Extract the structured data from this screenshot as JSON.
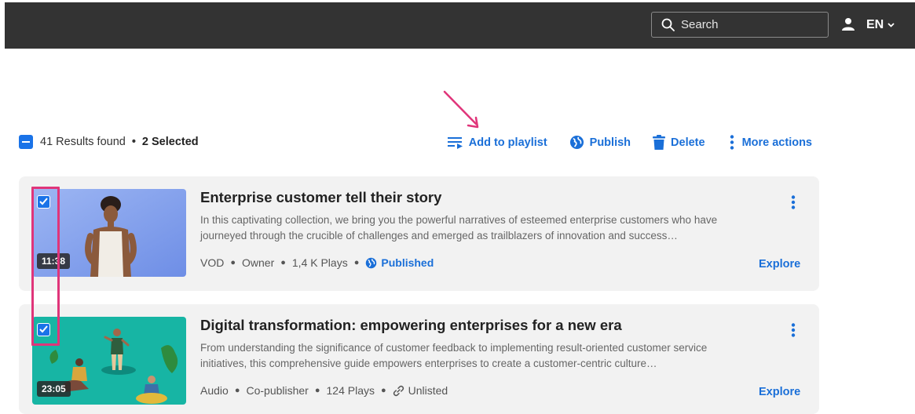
{
  "header": {
    "search_placeholder": "Search",
    "language": "EN"
  },
  "toolbar": {
    "results_text": "41 Results found",
    "selected_text": "2 Selected",
    "actions": [
      {
        "label": "Add to playlist",
        "icon": "add-to-playlist-icon"
      },
      {
        "label": "Publish",
        "icon": "globe-icon"
      },
      {
        "label": "Delete",
        "icon": "trash-icon"
      },
      {
        "label": "More actions",
        "icon": "kebab-icon"
      }
    ]
  },
  "entries": [
    {
      "title": "Enterprise customer tell their story",
      "description": "In this captivating collection, we bring you the powerful narratives of esteemed enterprise customers who have journeyed through the crucible of challenges and emerged as trailblazers of innovation and success…",
      "duration": "11:38",
      "type": "VOD",
      "role": "Owner",
      "plays": "1,4 K Plays",
      "status": "Published",
      "status_icon": "globe-icon",
      "explore": "Explore",
      "selected": true
    },
    {
      "title": "Digital transformation: empowering enterprises for a new era",
      "description": "From understanding the significance of customer feedback to implementing result-oriented customer service initiatives, this comprehensive guide empowers enterprises to create a customer-centric culture…",
      "duration": "23:05",
      "type": "Audio",
      "role": "Co-publisher",
      "plays": "124 Plays",
      "status": "Unlisted",
      "status_icon": "link-icon",
      "explore": "Explore",
      "selected": true
    }
  ],
  "colors": {
    "accent": "#1a6fd8",
    "topbar": "#333333",
    "annotation": "#e0357a"
  }
}
